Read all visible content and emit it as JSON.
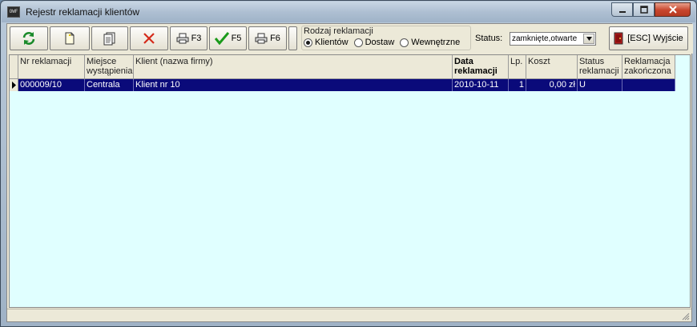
{
  "window": {
    "title": "Rejestr reklamacji klientów",
    "icon": "app-icon",
    "icon_text": "OWF"
  },
  "window_controls": {
    "minimize": "minimize-icon",
    "maximize": "maximize-icon",
    "close": "close-icon"
  },
  "toolbar": {
    "buttons": [
      {
        "name": "refresh-button",
        "icon": "refresh-icon",
        "label": ""
      },
      {
        "name": "new-button",
        "icon": "new-document-icon",
        "label": ""
      },
      {
        "name": "edit-button",
        "icon": "edit-document-icon",
        "label": ""
      },
      {
        "name": "delete-button",
        "icon": "delete-icon",
        "label": ""
      },
      {
        "name": "print-f3-button",
        "icon": "printer-icon",
        "label": "F3"
      },
      {
        "name": "confirm-f5-button",
        "icon": "checkmark-icon",
        "label": "F5"
      },
      {
        "name": "print-f6-button",
        "icon": "printer-icon",
        "label": "F6"
      }
    ],
    "complaint_type": {
      "label": "Rodzaj reklamacji",
      "options": [
        "Klientów",
        "Dostaw",
        "Wewnętrzne"
      ],
      "selected": "Klientów"
    },
    "status": {
      "label": "Status:",
      "value": "zamknięte,otwarte"
    },
    "exit": {
      "label": "[ESC] Wyjście",
      "icon": "exit-door-icon"
    }
  },
  "table": {
    "columns": [
      {
        "key": "nr",
        "label": "Nr reklamacji",
        "bold": false
      },
      {
        "key": "miejsce",
        "label": "Miejsce wystąpienia",
        "bold": false
      },
      {
        "key": "klient",
        "label": "Klient (nazwa firmy)",
        "bold": false
      },
      {
        "key": "data",
        "label": "Data reklamacji",
        "bold": true
      },
      {
        "key": "lp",
        "label": "Lp.",
        "bold": false
      },
      {
        "key": "koszt",
        "label": "Koszt",
        "bold": false
      },
      {
        "key": "status",
        "label": "Status reklamacji",
        "bold": false
      },
      {
        "key": "zakonczona",
        "label": "Reklamacja zakończona",
        "bold": false
      }
    ],
    "rows": [
      {
        "nr": "000009/10",
        "miejsce": "Centrala",
        "klient": "Klient nr 10",
        "data": "2010-10-11",
        "lp": "1",
        "koszt": "0,00 zł",
        "status": "U",
        "zakonczona": ""
      }
    ]
  },
  "colors": {
    "grid_background": "#e0ffff",
    "selected_row": "#0a0a7a",
    "close_button": "#c8452c"
  }
}
